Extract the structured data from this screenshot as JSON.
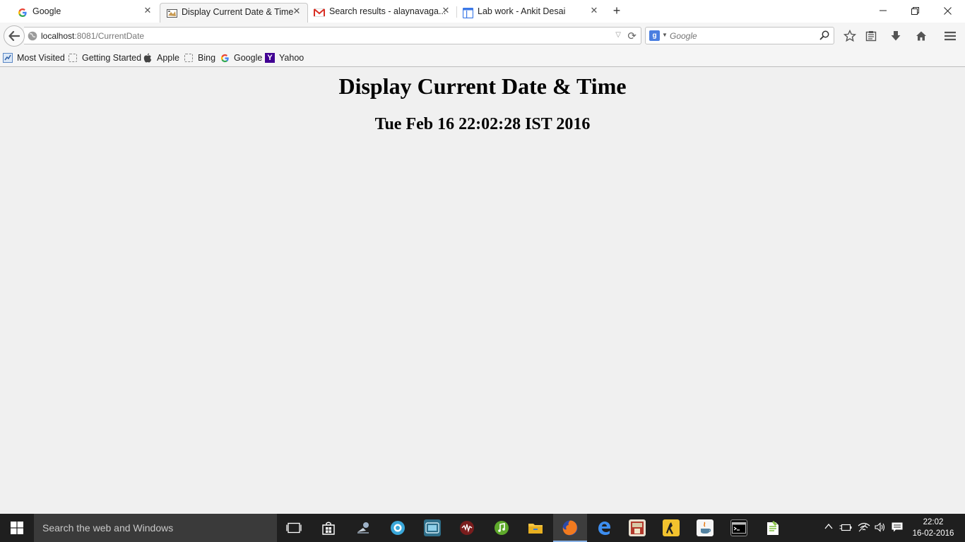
{
  "browser": {
    "tabs": [
      {
        "title": "Google",
        "favicon": "google-g-icon",
        "active": false
      },
      {
        "title": "Display Current Date & Time",
        "favicon": "page-icon",
        "active": true
      },
      {
        "title": "Search results - alaynavaga...",
        "favicon": "gmail-icon",
        "active": false
      },
      {
        "title": "Lab work - Ankit Desai",
        "favicon": "docs-icon",
        "active": false
      }
    ],
    "url_host": "localhost",
    "url_rest": ":8081/CurrentDate",
    "search_placeholder": "Google",
    "search_engine_label": "g",
    "bookmarks": [
      {
        "label": "Most Visited",
        "icon": "most-visited-icon"
      },
      {
        "label": "Getting Started",
        "icon": "dashed-bookmark-icon"
      },
      {
        "label": "Apple",
        "icon": "apple-icon"
      },
      {
        "label": "Bing",
        "icon": "dashed-bookmark-icon"
      },
      {
        "label": "Google",
        "icon": "google-g-icon"
      },
      {
        "label": "Yahoo",
        "icon": "yahoo-icon"
      }
    ]
  },
  "page": {
    "heading": "Display Current Date & Time",
    "datetime": "Tue Feb 16 22:02:28 IST 2016"
  },
  "taskbar": {
    "search_placeholder": "Search the web and Windows",
    "clock_time": "22:02",
    "clock_date": "16-02-2016"
  },
  "colors": {
    "page_bg": "#f0f0f0",
    "taskbar_bg": "#1f1f1f",
    "accent": "#8ab4e8"
  }
}
